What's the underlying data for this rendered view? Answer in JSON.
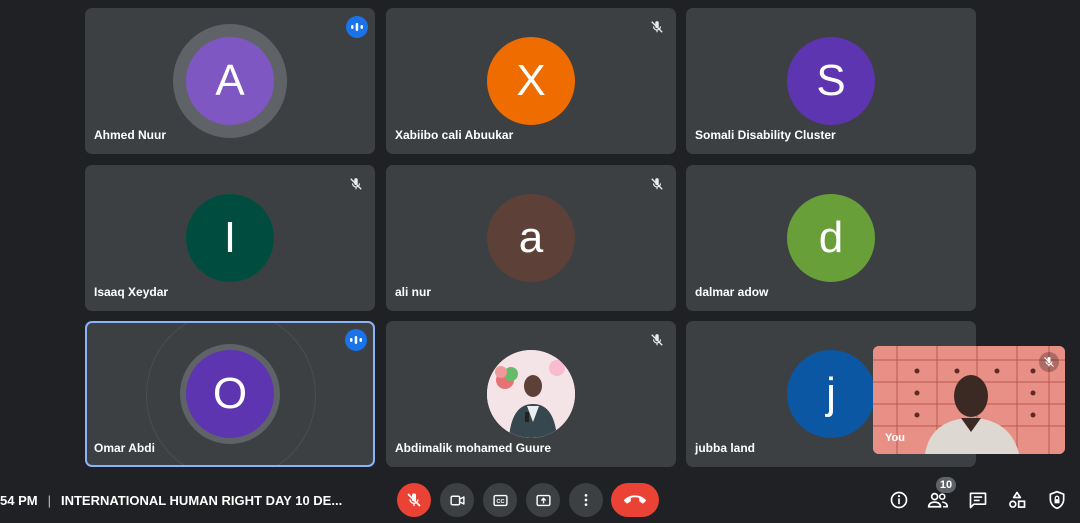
{
  "participants": [
    {
      "name": "Ahmed Nuur",
      "initial": "A",
      "color": "#7e57c2",
      "status": "speaking"
    },
    {
      "name": "Xabiibo cali Abuukar",
      "initial": "X",
      "color": "#ef6c00",
      "status": "muted"
    },
    {
      "name": "Somali Disability Cluster",
      "initial": "S",
      "color": "#5e35b1",
      "status": "none"
    },
    {
      "name": "Isaaq Xeydar",
      "initial": "I",
      "color": "#004d40",
      "status": "muted"
    },
    {
      "name": "ali nur",
      "initial": "a",
      "color": "#5d4037",
      "status": "muted"
    },
    {
      "name": "dalmar adow",
      "initial": "d",
      "color": "#689f38",
      "status": "none"
    },
    {
      "name": "Omar Abdi",
      "initial": "O",
      "color": "#5e35b1",
      "status": "speaking"
    },
    {
      "name": "Abdimalik mohamed Guure",
      "initial": "",
      "color": "#f2e2e6",
      "status": "muted"
    },
    {
      "name": "jubba land",
      "initial": "j",
      "color": "#0b57a4",
      "status": "none"
    }
  ],
  "self_view": {
    "label": "You",
    "muted": true
  },
  "meeting": {
    "time": "54 PM",
    "title": "INTERNATIONAL HUMAN RIGHT DAY 10 DE..."
  },
  "controls": {
    "mic": "mic-off-icon",
    "camera": "videocam-icon",
    "captions": "closed-captions-icon",
    "present": "present-screen-icon",
    "more": "more-vert-icon",
    "end_call": "call-end-icon"
  },
  "right_controls": {
    "info": "info-icon",
    "people": "people-icon",
    "people_count": "10",
    "chat": "chat-icon",
    "activities": "activities-icon",
    "host": "host-controls-icon"
  },
  "colors": {
    "background": "#202124",
    "tile": "#3c4043",
    "accent": "#1a73e8",
    "end": "#ea4335"
  }
}
